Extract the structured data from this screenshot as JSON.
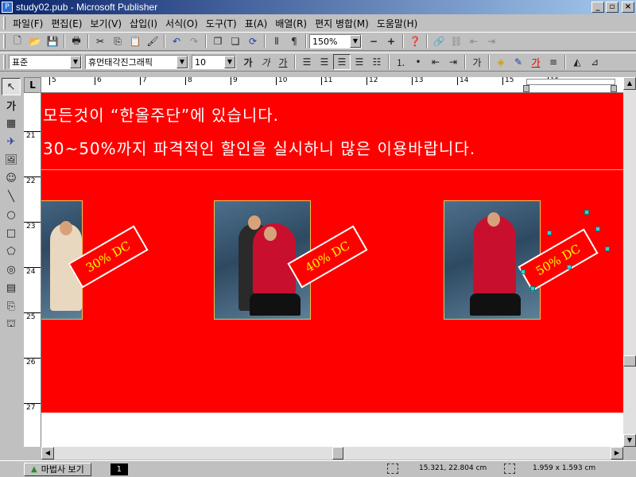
{
  "window": {
    "title": "study02.pub - Microsoft Publisher",
    "app_icon": "publisher-icon",
    "buttons": [
      "_",
      "▫",
      "×"
    ]
  },
  "menubar": {
    "items": [
      "파일(F)",
      "편집(E)",
      "보기(V)",
      "삽입(I)",
      "서식(O)",
      "도구(T)",
      "표(A)",
      "배열(R)",
      "편지 병합(M)",
      "도움말(H)"
    ]
  },
  "standard_toolbar": {
    "zoom": "150%"
  },
  "format_toolbar": {
    "style": "표준",
    "font": "휴먼태각진그래픽",
    "size": "10",
    "bold_label": "가",
    "italic_label": "가",
    "underline_label": "가",
    "fontcolor_label": "가",
    "superscript_label": "가"
  },
  "tools": {
    "text_tool_label": "가"
  },
  "rulers": {
    "corner_label": "L",
    "h_ticks": [
      "5",
      "6",
      "7",
      "8",
      "9",
      "10",
      "11",
      "12",
      "13",
      "14",
      "15",
      "16"
    ],
    "v_ticks": [
      "21",
      "22",
      "23",
      "24",
      "25",
      "26",
      "27"
    ]
  },
  "document": {
    "line1": "모든것이 “한올주단”에 있습니다.",
    "line2": "30~50%까지 파격적인 할인을 실시하니 많은 이용바랍니다.",
    "labels": [
      "30% DC",
      "40% DC",
      "50% DC"
    ],
    "colors": {
      "background": "#ff0000",
      "text": "#ffffff",
      "label_text": "#ffff00"
    }
  },
  "statusbar": {
    "wizard_label": "마법사 보기",
    "page": "1",
    "position": "15.321, 22.804 cm",
    "size": "1.959 x   1.593 cm"
  }
}
